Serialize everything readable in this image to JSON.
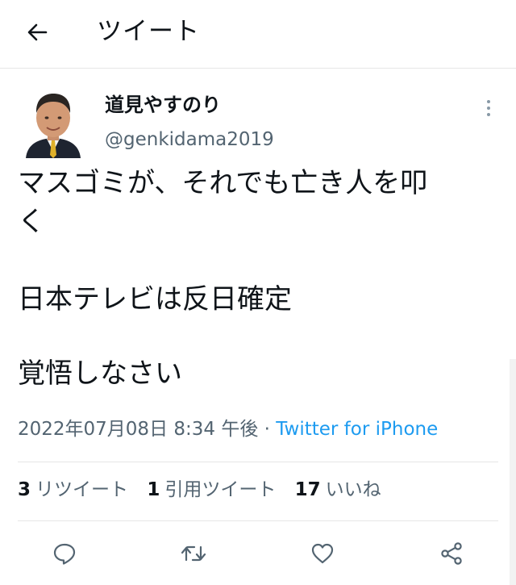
{
  "header": {
    "title": "ツイート",
    "back_icon": "arrow-left-icon"
  },
  "tweet": {
    "author_name": "道見やすのり",
    "author_handle": "@genkidama2019",
    "text_lines": [
      "マスゴミが、それでも亡き人を叩",
      "く",
      "日本テレビは反日確定",
      "覚悟しなさい"
    ],
    "timestamp": "2022年07月08日 8:34 午後",
    "separator": "·",
    "source": "Twitter for iPhone"
  },
  "stats": {
    "retweets_count": "3",
    "retweets_label": "リツイート",
    "quotes_count": "1",
    "quotes_label": "引用ツイート",
    "likes_count": "17",
    "likes_label": "いいね"
  },
  "actions": {
    "reply_icon": "reply-icon",
    "retweet_icon": "retweet-icon",
    "like_icon": "heart-icon",
    "share_icon": "share-icon"
  },
  "colors": {
    "text": "#0f1419",
    "secondary": "#536471",
    "link": "#1d9bf0",
    "divider": "#e6e6e6"
  }
}
